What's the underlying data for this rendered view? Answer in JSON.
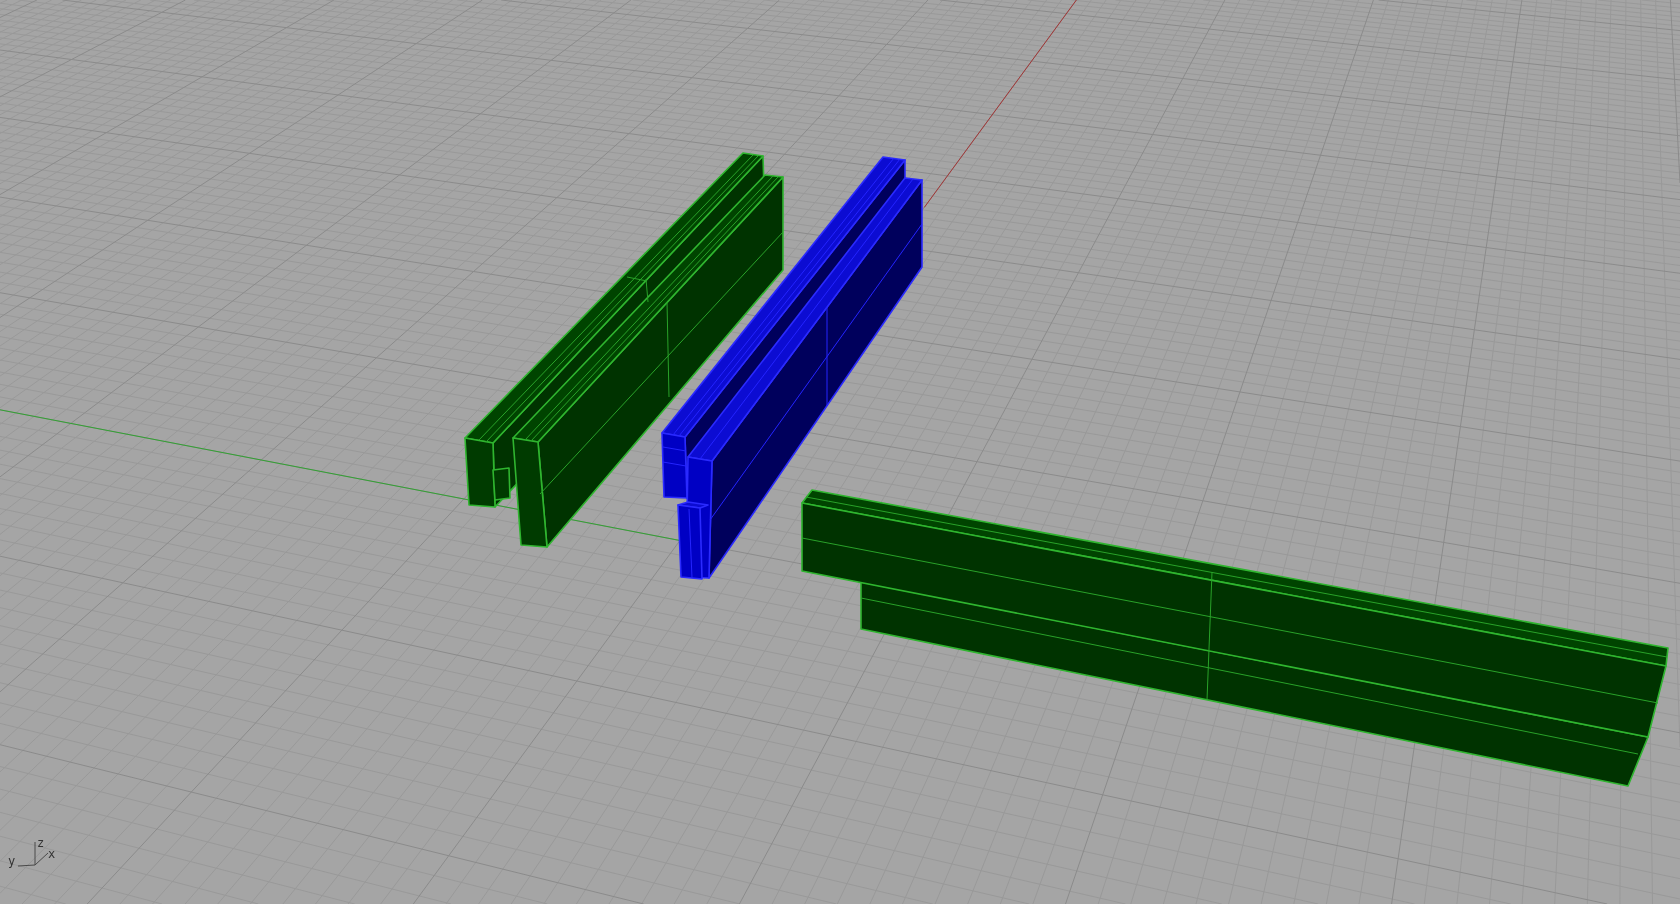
{
  "viewport": {
    "objects": [
      {
        "kind": "upright",
        "selected": false
      },
      {
        "kind": "notched",
        "selected": true
      },
      {
        "kind": "lying",
        "selected": false
      }
    ],
    "axis_widget": {
      "z_label": "z",
      "x_label": "x",
      "y_label": "y"
    }
  }
}
